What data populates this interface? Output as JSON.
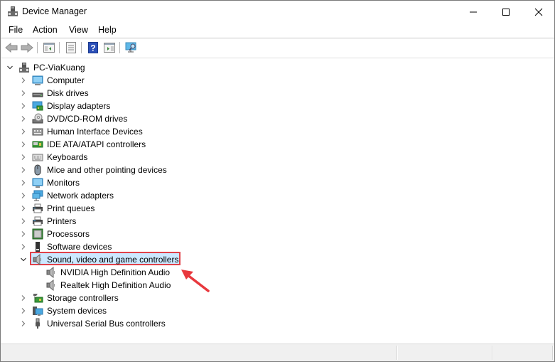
{
  "window": {
    "title": "Device Manager",
    "icon": "device-manager-icon",
    "controls": {
      "minimize": "minimize-icon",
      "maximize": "maximize-icon",
      "close": "close-icon"
    }
  },
  "menubar": {
    "items": [
      {
        "label": "File"
      },
      {
        "label": "Action"
      },
      {
        "label": "View"
      },
      {
        "label": "Help"
      }
    ]
  },
  "toolbar": {
    "buttons": [
      {
        "icon": "back-arrow-icon"
      },
      {
        "icon": "forward-arrow-icon"
      },
      {
        "icon": "show-hide-console-tree-icon"
      },
      {
        "icon": "properties-icon"
      },
      {
        "icon": "help-icon"
      },
      {
        "icon": "show-action-pane-icon"
      },
      {
        "icon": "scan-hardware-changes-icon"
      }
    ]
  },
  "tree": {
    "root": {
      "label": "PC-ViaKuang",
      "icon": "computer-root-icon",
      "expanded": true
    },
    "categories": [
      {
        "label": "Computer",
        "icon": "computer-icon",
        "expanded": false
      },
      {
        "label": "Disk drives",
        "icon": "disk-drive-icon",
        "expanded": false
      },
      {
        "label": "Display adapters",
        "icon": "display-adapter-icon",
        "expanded": false
      },
      {
        "label": "DVD/CD-ROM drives",
        "icon": "dvd-drive-icon",
        "expanded": false
      },
      {
        "label": "Human Interface Devices",
        "icon": "hid-icon",
        "expanded": false
      },
      {
        "label": "IDE ATA/ATAPI controllers",
        "icon": "ide-controller-icon",
        "expanded": false
      },
      {
        "label": "Keyboards",
        "icon": "keyboard-icon",
        "expanded": false
      },
      {
        "label": "Mice and other pointing devices",
        "icon": "mouse-icon",
        "expanded": false
      },
      {
        "label": "Monitors",
        "icon": "monitor-icon",
        "expanded": false
      },
      {
        "label": "Network adapters",
        "icon": "network-adapter-icon",
        "expanded": false
      },
      {
        "label": "Print queues",
        "icon": "print-queue-icon",
        "expanded": false
      },
      {
        "label": "Printers",
        "icon": "printer-icon",
        "expanded": false
      },
      {
        "label": "Processors",
        "icon": "processor-icon",
        "expanded": false
      },
      {
        "label": "Software devices",
        "icon": "software-device-icon",
        "expanded": false
      },
      {
        "label": "Sound, video and game controllers",
        "icon": "speaker-icon",
        "expanded": true,
        "selected": true,
        "children": [
          {
            "label": "NVIDIA High Definition Audio",
            "icon": "speaker-icon"
          },
          {
            "label": "Realtek High Definition Audio",
            "icon": "speaker-icon"
          }
        ]
      },
      {
        "label": "Storage controllers",
        "icon": "storage-controller-icon",
        "expanded": false
      },
      {
        "label": "System devices",
        "icon": "system-device-icon",
        "expanded": false
      },
      {
        "label": "Universal Serial Bus controllers",
        "icon": "usb-icon",
        "expanded": false
      }
    ]
  },
  "annotation": {
    "highlight_color": "#e0424a",
    "arrow_color": "#e8383d",
    "target": "Sound, video and game controllers"
  },
  "colors": {
    "selection": "#cce8ff",
    "statusbar": "#f0f0f0"
  }
}
